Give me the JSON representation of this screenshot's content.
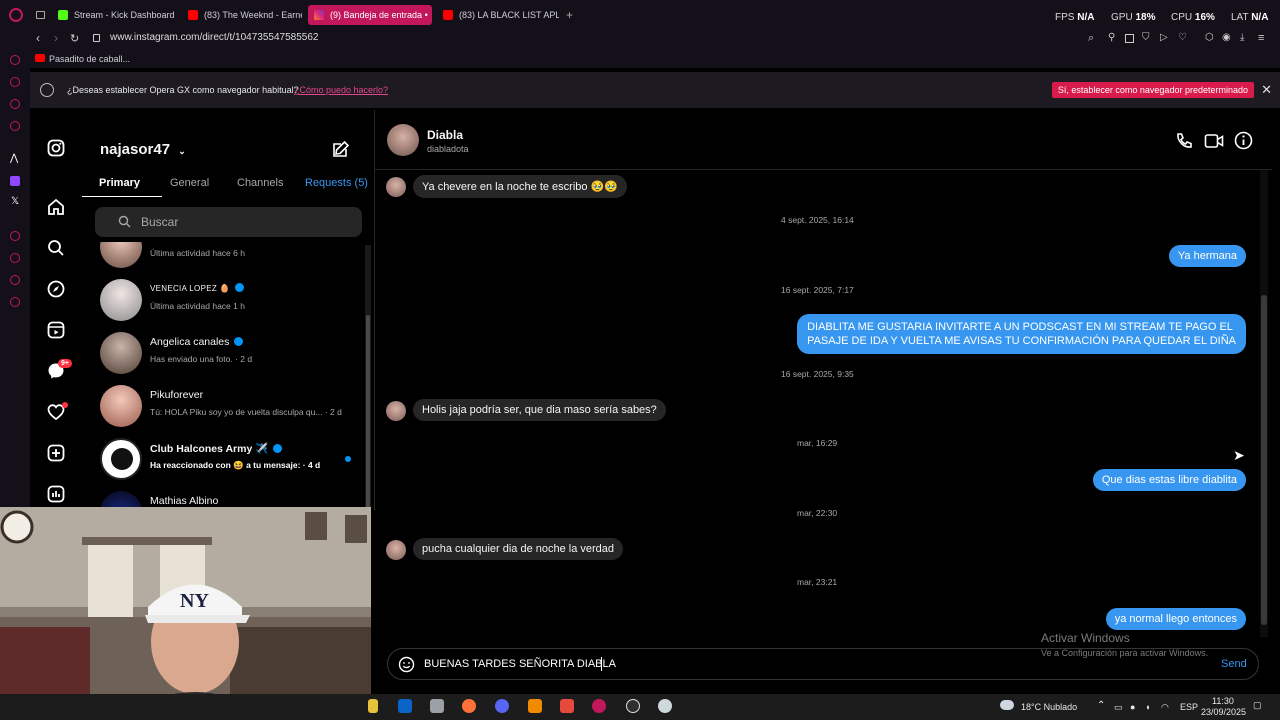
{
  "browser": {
    "tabs": [
      {
        "label": "Stream - Kick Dashboard",
        "color": "#53fc18"
      },
      {
        "label": "(83) The Weeknd - Earne",
        "color": "#ff0000"
      },
      {
        "label": "(9) Bandeja de entrada •",
        "color": "#e1306c"
      },
      {
        "label": "(83) LA BLACK LIST APLA",
        "color": "#ff0000"
      }
    ],
    "new_tab": "+",
    "stats": {
      "fps_label": "FPS",
      "fps": "N/A",
      "gpu_label": "GPU",
      "gpu": "18%",
      "cpu_label": "CPU",
      "cpu": "16%",
      "lat_label": "LAT",
      "lat": "N/A"
    },
    "url": "www.instagram.com/direct/t/104735547585562",
    "bookmark": "Pasadito de caball...",
    "notice": {
      "text": "¿Deseas establecer Opera GX como navegador habitual?",
      "link": "¿Cómo puedo hacerlo?",
      "cta": "Sí, establecer como navegador predeterminado"
    }
  },
  "inbox": {
    "username": "najasor47",
    "tabs": [
      "Primary",
      "General",
      "Channels",
      "Requests (5)"
    ],
    "search_placeholder": "Buscar",
    "rows": [
      {
        "name": "",
        "sub": "Última actividad hace 6 h"
      },
      {
        "name": "VENECIA LOPEZ 🥚",
        "sub": "Última actividad hace 1 h",
        "verified": true
      },
      {
        "name": "Angelica canales",
        "sub": "Has enviado una foto. · 2 d",
        "verified": true
      },
      {
        "name": "Pikuforever",
        "sub": "Tú: HOLA Piku soy yo de vuelta disculpa qu... · 2 d"
      },
      {
        "name": "Club Halcones Army ✈️",
        "sub": "Ha reaccionado con 😆 a tu mensaje: · 4 d",
        "verified": true
      },
      {
        "name": "Mathias Albino",
        "sub": ""
      }
    ],
    "badge": "9+"
  },
  "chat": {
    "name": "Diabla",
    "handle": "diabladota",
    "messages": [
      {
        "dir": "in",
        "text": "Ya chevere en la noche te escribo 🥹🥹"
      },
      {
        "dir": "ts",
        "text": "4 sept. 2025, 16:14"
      },
      {
        "dir": "out",
        "text": "Ya hermana"
      },
      {
        "dir": "ts",
        "text": "16 sept. 2025, 7:17"
      },
      {
        "dir": "out",
        "text": "DIABLITA ME GUSTARIA INVITARTE A UN PODSCAST EN MI STREAM TE PAGO EL",
        "text2": "PASAJE DE IDA Y VUELTA ME AVISAS TU CONFIRMACIÓN PARA QUEDAR EL DIÑA"
      },
      {
        "dir": "ts",
        "text": "16 sept. 2025, 9:35"
      },
      {
        "dir": "in",
        "text": "Holis jaja podría ser, que dia maso sería sabes?"
      },
      {
        "dir": "ts",
        "text": "mar, 16:29"
      },
      {
        "dir": "out",
        "text": "Que dias estas libre diablita"
      },
      {
        "dir": "ts",
        "text": "mar, 22:30"
      },
      {
        "dir": "in",
        "text": "pucha cualquier dia de noche la verdad"
      },
      {
        "dir": "ts",
        "text": "mar, 23:21"
      },
      {
        "dir": "out",
        "text": "ya normal llego entonces"
      }
    ],
    "composer_value": "BUENAS TARDES SEÑORITA DIABLA",
    "send_label": "Send",
    "watermark_title": "Activar Windows",
    "watermark_sub": "Ve a Configuración para activar Windows."
  },
  "taskbar": {
    "weather": "18°C  Nublado",
    "lang": "ESP",
    "time": "11:30",
    "date": "23/09/2025"
  },
  "colors": {
    "accent": "#c2185b",
    "ig_blue": "#3797f0",
    "bubble_in": "#262626"
  }
}
